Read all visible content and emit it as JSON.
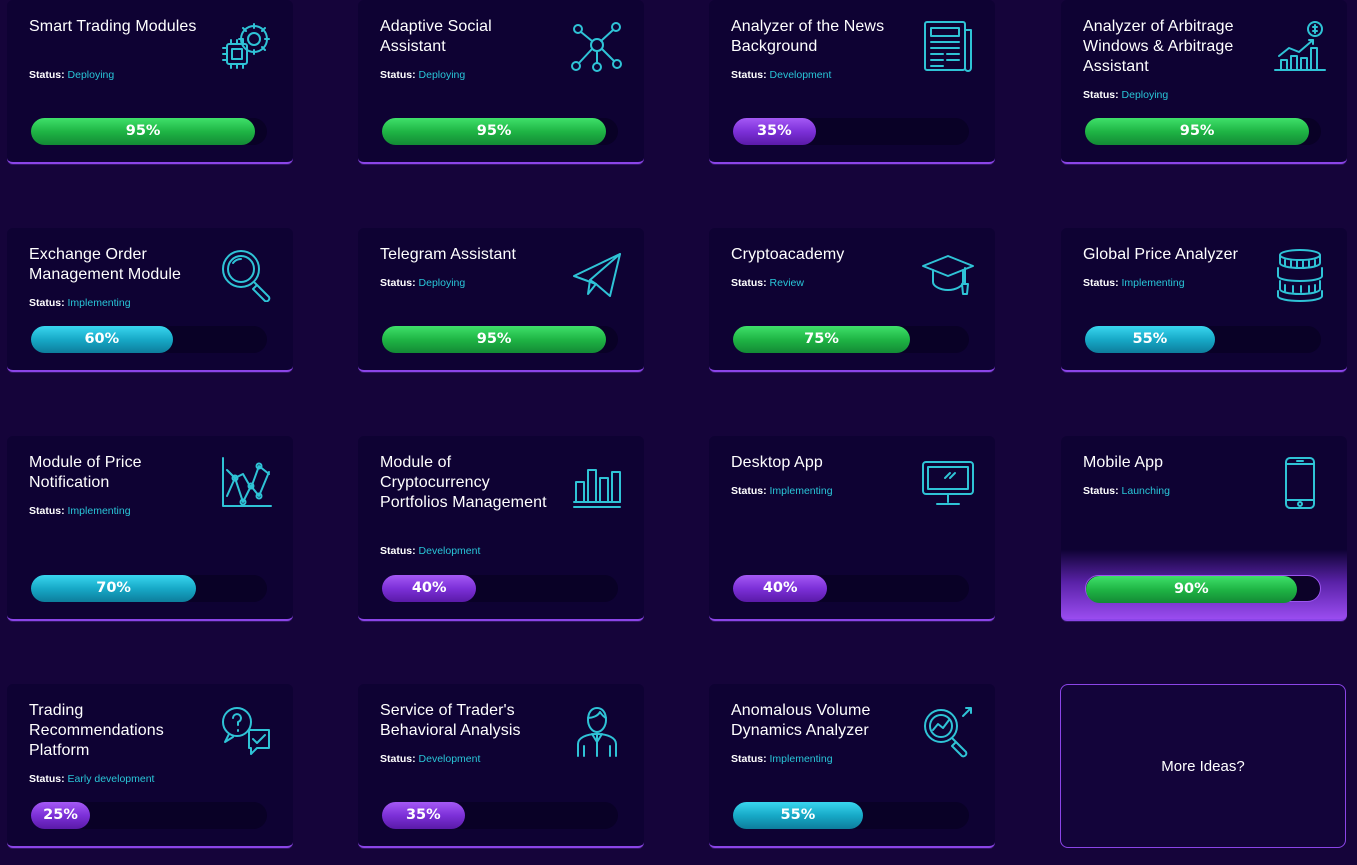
{
  "status_label": "Status:",
  "colors": {
    "background": "#15043a",
    "card": "#0e0233",
    "accent_border": "#8b45e8",
    "status_text": "#29c6d8",
    "bar_green": "#1fb545",
    "bar_blue": "#17a9c7",
    "bar_purple": "#7c30d8"
  },
  "cards": [
    {
      "title": "Smart Trading Modules",
      "status": "Deploying",
      "progress": 95,
      "progress_label": "95%",
      "bar_color": "green",
      "icon": "chip-gear-icon"
    },
    {
      "title": "Adaptive Social Assistant",
      "status": "Deploying",
      "progress": 95,
      "progress_label": "95%",
      "bar_color": "green",
      "icon": "network-nodes-icon"
    },
    {
      "title": "Analyzer of the News Background",
      "status": "Development",
      "progress": 35,
      "progress_label": "35%",
      "bar_color": "purple",
      "icon": "newspaper-icon"
    },
    {
      "title": "Analyzer of Arbitrage Windows & Arbitrage Assistant",
      "status": "Deploying",
      "progress": 95,
      "progress_label": "95%",
      "bar_color": "green",
      "icon": "growth-chart-dollar-icon"
    },
    {
      "title": "Exchange Order Management Module",
      "status": "Implementing",
      "progress": 60,
      "progress_label": "60%",
      "bar_color": "blue",
      "icon": "magnifier-icon"
    },
    {
      "title": "Telegram Assistant",
      "status": "Deploying",
      "progress": 95,
      "progress_label": "95%",
      "bar_color": "green",
      "icon": "paper-plane-icon"
    },
    {
      "title": "Cryptoacademy",
      "status": "Review",
      "progress": 75,
      "progress_label": "75%",
      "bar_color": "green",
      "icon": "graduation-cap-icon"
    },
    {
      "title": "Global Price Analyzer",
      "status": "Implementing",
      "progress": 55,
      "progress_label": "55%",
      "bar_color": "blue",
      "icon": "coin-stack-icon"
    },
    {
      "title": "Module of Price Notification",
      "status": "Implementing",
      "progress": 70,
      "progress_label": "70%",
      "bar_color": "blue",
      "icon": "line-chart-icon"
    },
    {
      "title": "Module of Cryptocurrency Portfolios Management",
      "status": "Development",
      "progress": 40,
      "progress_label": "40%",
      "bar_color": "purple",
      "icon": "bar-chart-icon"
    },
    {
      "title": "Desktop App",
      "status": "Implementing",
      "progress": 40,
      "progress_label": "40%",
      "bar_color": "purple",
      "icon": "desktop-monitor-icon"
    },
    {
      "title": "Mobile App",
      "status": "Launching",
      "progress": 90,
      "progress_label": "90%",
      "bar_color": "green",
      "icon": "smartphone-icon",
      "highlight": true
    },
    {
      "title": "Trading Recommendations Platform",
      "status": "Early development",
      "progress": 25,
      "progress_label": "25%",
      "bar_color": "purple",
      "icon": "chat-bubbles-icon"
    },
    {
      "title": "Service of Trader's Behavioral Analysis",
      "status": "Development",
      "progress": 35,
      "progress_label": "35%",
      "bar_color": "purple",
      "icon": "person-icon"
    },
    {
      "title": "Anomalous Volume Dynamics Analyzer",
      "status": "Implementing",
      "progress": 55,
      "progress_label": "55%",
      "bar_color": "blue",
      "icon": "magnifier-chart-icon"
    }
  ],
  "more_ideas": {
    "label": "More Ideas?"
  }
}
